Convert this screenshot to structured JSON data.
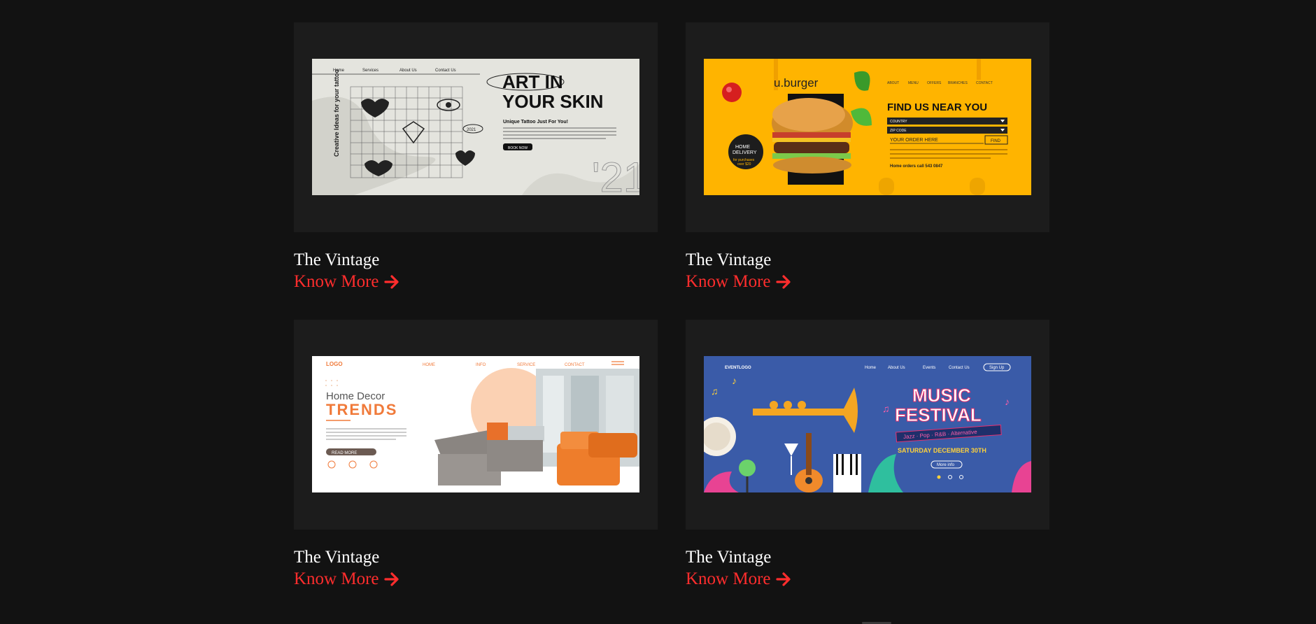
{
  "colors": {
    "background": "#121212",
    "card": "#1c1c1c",
    "title": "#ffffff",
    "link": "#ff2d2d"
  },
  "projects": [
    {
      "title": "The Vintage",
      "link_label": "Know More",
      "link_icon": "arrow-right-icon",
      "thumbnail": {
        "theme": "tattoo-studio",
        "nav": [
          "Home",
          "Services",
          "About Us",
          "Contact Us"
        ],
        "headline_line1": "ART IN",
        "headline_line2": "YOUR SKIN",
        "subheadline": "Unique Tattoo Just For You!",
        "side_text": "Creative Ideas for your tattoo",
        "button": "BOOK NOW",
        "badge": "2021",
        "corner_number": "'21"
      }
    },
    {
      "title": "The Vintage",
      "link_label": "Know More",
      "link_icon": "arrow-right-icon",
      "thumbnail": {
        "theme": "burger-restaurant",
        "logo": "u.burger",
        "nav": [
          "ABOUT",
          "MENU",
          "OFFERS",
          "BRANCHES",
          "CONTACT"
        ],
        "heading": "FIND US NEAR YOU",
        "select_1": "COUNTRY",
        "select_2": "ZIP CODE",
        "order_text": "YOUR ORDER HERE",
        "find_button": "FIND",
        "delivery_badge_1": "HOME",
        "delivery_badge_2": "DELIVERY",
        "delivery_badge_3": "for purchases",
        "delivery_badge_4": "over $20",
        "phone": "Home orders call 543 0847"
      }
    },
    {
      "title": "The Vintage",
      "link_label": "Know More",
      "link_icon": "arrow-right-icon",
      "thumbnail": {
        "theme": "home-decor",
        "logo": "LOGO",
        "nav": [
          "HOME",
          "INFO",
          "SERVICE",
          "CONTACT"
        ],
        "heading_1": "Home Decor",
        "heading_2": "TRENDS",
        "button": "READ MORE"
      }
    },
    {
      "title": "The Vintage",
      "link_label": "Know More",
      "link_icon": "arrow-right-icon",
      "thumbnail": {
        "theme": "music-festival",
        "logo": "EVENTLOGO",
        "nav": [
          "Home",
          "About Us",
          "Events",
          "Contact Us"
        ],
        "signup": "Sign Up",
        "heading_1": "MUSIC",
        "heading_2": "FESTIVAL",
        "genres": "Jazz · Pop · R&B · Alternative",
        "date": "SATURDAY DECEMBER 30TH",
        "button": "More info"
      }
    }
  ]
}
